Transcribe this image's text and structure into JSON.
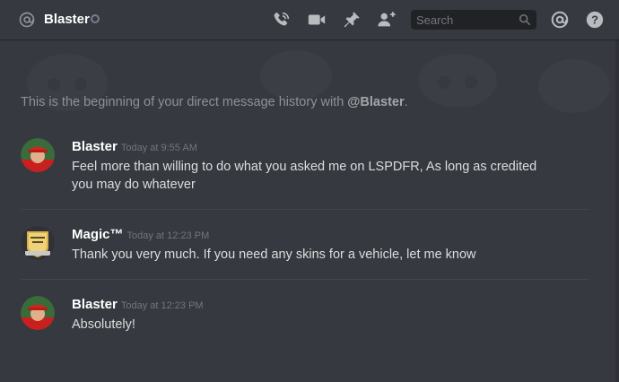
{
  "header": {
    "channel_name": "Blaster",
    "status": "offline",
    "icons": [
      "call-icon",
      "video-call-icon",
      "pin-icon",
      "add-friend-icon",
      "mentions-icon",
      "help-icon"
    ],
    "search_placeholder": "Search"
  },
  "intro": {
    "prefix": "This is the beginning of your direct message history with ",
    "mention": "@Blaster",
    "suffix": "."
  },
  "messages": [
    {
      "author": "Blaster",
      "timestamp": "Today at 9:55 AM",
      "text": "Feel more than willing to do what you asked me on LSPDFR, As long as credited you may do whatever",
      "avatar": "avatar-red-cap"
    },
    {
      "author": "Magic™",
      "timestamp": "Today at 12:23 PM",
      "text": "Thank you very much. If you need any skins for a vehicle, let me know",
      "avatar": "avatar-gold-badge"
    },
    {
      "author": "Blaster",
      "timestamp": "Today at 12:23 PM",
      "text": "Absolutely!",
      "avatar": "avatar-red-cap"
    }
  ],
  "colors": {
    "background": "#36393f",
    "header_icons": "#b9bbbe",
    "search_bg": "#202225",
    "muted_text": "#8e9297",
    "timestamp": "#72767d"
  }
}
